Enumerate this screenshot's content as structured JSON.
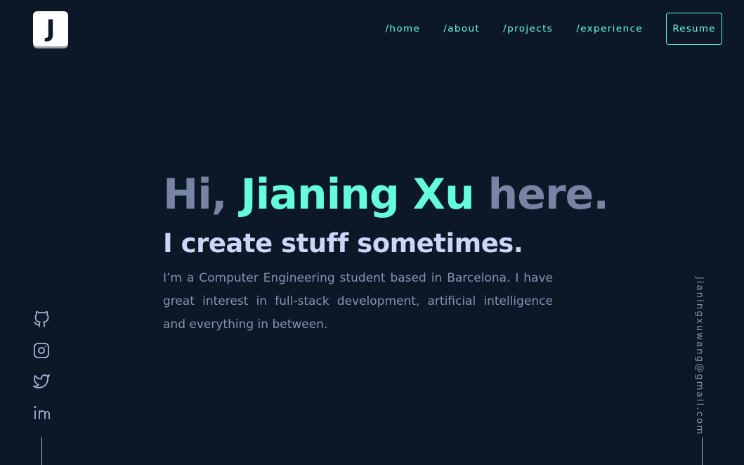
{
  "logo": {
    "letter": "J"
  },
  "nav": {
    "links": [
      {
        "label": "/home"
      },
      {
        "label": "/about"
      },
      {
        "label": "/projects"
      },
      {
        "label": "/experience"
      }
    ],
    "resume_label": "Resume"
  },
  "hero": {
    "greeting_prefix": "Hi,",
    "name": "Jianing Xu",
    "greeting_suffix": "here.",
    "subtitle": "I create stuff sometimes.",
    "intro": "I’m a Computer Engineering student based in Barcelona. I have great interest in full-stack development, artificial intelligence and everything in between."
  },
  "socials": {
    "items": [
      {
        "icon": "github-icon"
      },
      {
        "icon": "instagram-icon"
      },
      {
        "icon": "twitter-icon"
      },
      {
        "icon": "linkedin-icon"
      }
    ]
  },
  "email": "jianingxuwang@gmail.com",
  "colors": {
    "background": "#0c1728",
    "accent": "#64ffda",
    "heading": "#ccd6f6",
    "muted": "#8892b0"
  }
}
